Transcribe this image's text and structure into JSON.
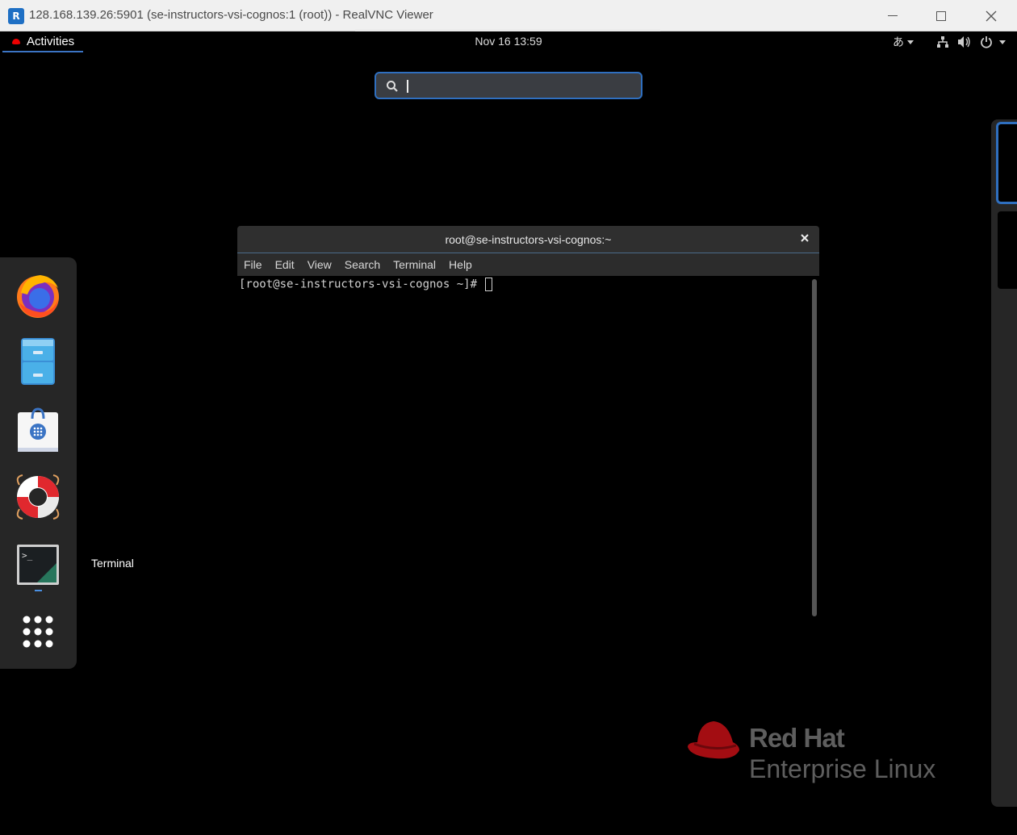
{
  "vnc_window": {
    "title": "128.168.139.26:5901 (se-instructors-vsi-cognos:1 (root)) - RealVNC Viewer",
    "app_icon_letter": "R"
  },
  "topbar": {
    "activities_label": "Activities",
    "clock": "Nov 16  13:59",
    "input_method": "あ"
  },
  "search": {
    "value": "",
    "placeholder": ""
  },
  "dock": {
    "items": [
      {
        "name": "Firefox",
        "icon": "firefox-icon"
      },
      {
        "name": "Files",
        "icon": "file-cabinet-icon"
      },
      {
        "name": "Software",
        "icon": "software-bag-icon"
      },
      {
        "name": "Help",
        "icon": "lifebuoy-icon"
      },
      {
        "name": "Terminal",
        "icon": "terminal-icon"
      },
      {
        "name": "Show Applications",
        "icon": "app-grid-icon"
      }
    ],
    "hover_tooltip": "Terminal"
  },
  "terminal": {
    "title": "root@se-instructors-vsi-cognos:~",
    "menu": [
      "File",
      "Edit",
      "View",
      "Search",
      "Terminal",
      "Help"
    ],
    "prompt": "[root@se-instructors-vsi-cognos ~]# "
  },
  "branding": {
    "line1": "Red Hat",
    "line2": "Enterprise Linux",
    "brand_color": "#c00"
  }
}
